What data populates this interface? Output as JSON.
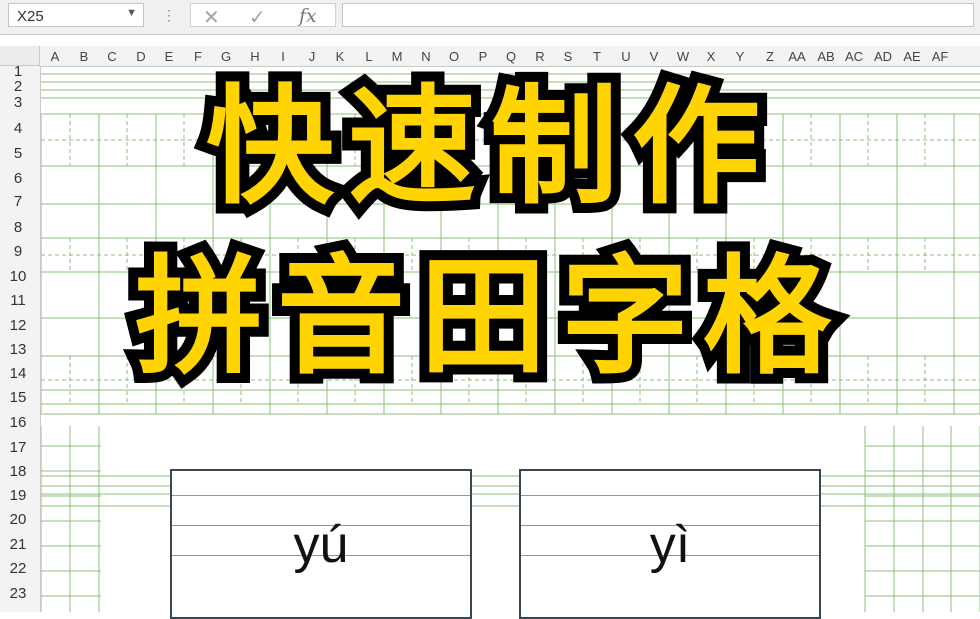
{
  "formula_bar": {
    "name_box": "X25",
    "dropdown_glyph": "▼",
    "separator": "⋮",
    "cancel_icon": "✕",
    "enter_icon": "✓",
    "fx_label": "fx",
    "formula_value": ""
  },
  "columns": [
    "A",
    "B",
    "C",
    "D",
    "E",
    "F",
    "G",
    "H",
    "I",
    "J",
    "K",
    "L",
    "M",
    "N",
    "O",
    "P",
    "Q",
    "R",
    "S",
    "T",
    "U",
    "V",
    "W",
    "X",
    "Y",
    "Z",
    "AA",
    "AB",
    "AC",
    "AD",
    "AE",
    "AF"
  ],
  "rows": [
    "1",
    "2",
    "3",
    "4",
    "5",
    "6",
    "7",
    "8",
    "9",
    "10",
    "11",
    "12",
    "13",
    "14",
    "15",
    "16",
    "17",
    "18",
    "19",
    "20",
    "21",
    "22",
    "23"
  ],
  "title": {
    "line1": "快速制作",
    "line2": "拼音田字格"
  },
  "cards": [
    {
      "pinyin": "yú"
    },
    {
      "pinyin": "yì"
    }
  ],
  "colors": {
    "title_fill": "#ffd400",
    "title_outline": "#000000",
    "grid_line": "#8cbf7a",
    "card_border": "#3a4650",
    "card_rule": "#7d9bb5"
  }
}
